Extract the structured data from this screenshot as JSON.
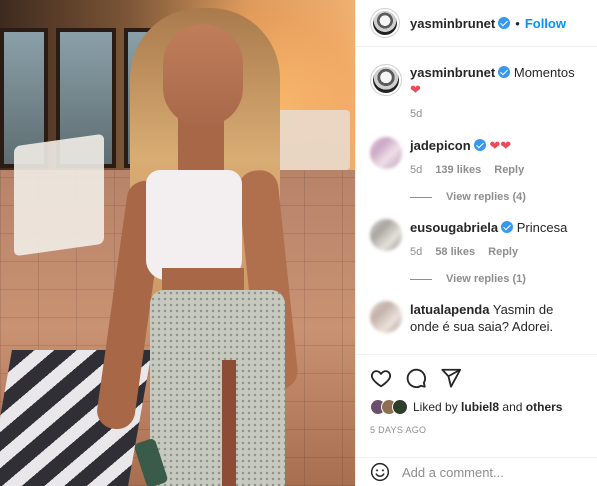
{
  "post": {
    "author": "yasminbrunet",
    "follow_label": "Follow",
    "separator": "•",
    "caption_author": "yasminbrunet",
    "caption": "Momentos",
    "caption_emoji": "❤",
    "caption_age": "5d"
  },
  "comments": [
    {
      "user": "jadepicon",
      "text": "",
      "emoji": "❤❤",
      "age": "5d",
      "likes": "139 likes",
      "reply": "Reply",
      "view_replies": "View replies (4)",
      "verified": true
    },
    {
      "user": "eusougabriela",
      "text": "Princesa",
      "emoji": "",
      "age": "5d",
      "likes": "58 likes",
      "reply": "Reply",
      "view_replies": "View replies (1)",
      "verified": true
    },
    {
      "user": "latualapenda",
      "text": "Yasmin de onde é sua saia? Adorei.",
      "emoji": "",
      "age": "",
      "likes": "",
      "reply": "",
      "view_replies": "",
      "verified": false
    }
  ],
  "actions": {
    "like_icon": "heart-icon",
    "comment_icon": "comment-icon",
    "share_icon": "share-icon"
  },
  "likes": {
    "prefix": "Liked by",
    "user": "lubiel8",
    "connector": "and",
    "suffix": "others"
  },
  "timestamp": "5 DAYS AGO",
  "add_comment": {
    "placeholder": "Add a comment...",
    "icon": "smile-icon"
  },
  "colors": {
    "link": "#0095f6",
    "verified": "#3897f0",
    "heart": "#ed4956",
    "muted": "#8e8e8e"
  }
}
